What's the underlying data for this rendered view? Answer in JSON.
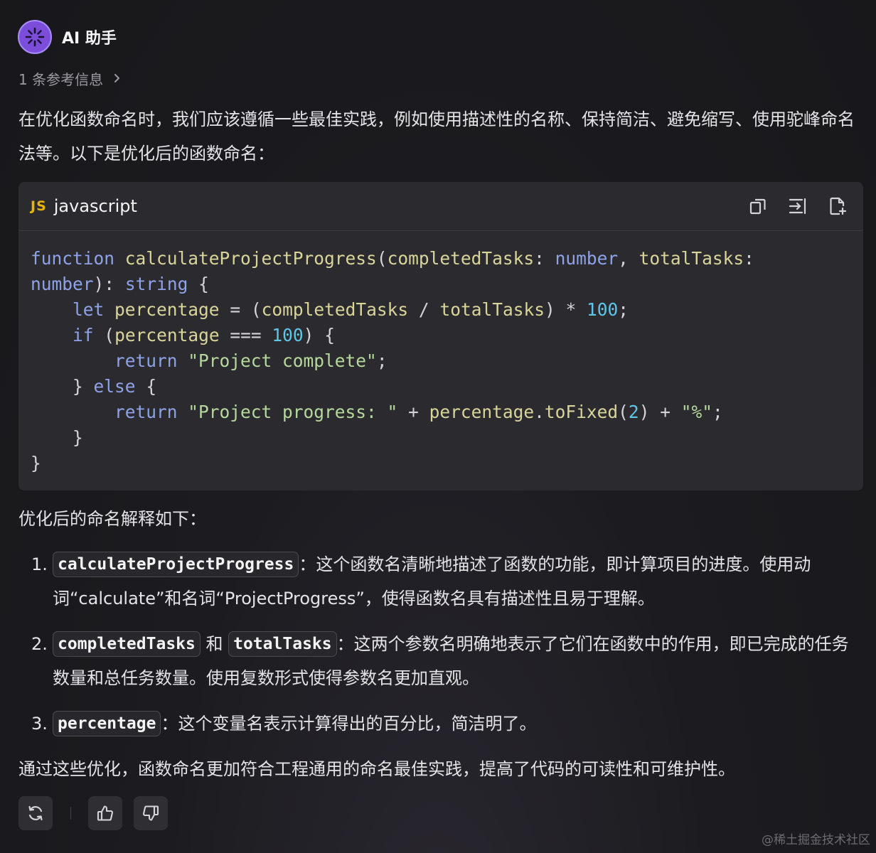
{
  "header": {
    "assistant_name": "AI 助手",
    "avatar_icon": "sparkle-icon",
    "avatar_color": "#7c4ddb"
  },
  "references": {
    "label": "1 条参考信息",
    "icon": "chevron-right-icon"
  },
  "intro_text": "在优化函数命名时，我们应该遵循一些最佳实践，例如使用描述性的名称、保持简洁、避免缩写、使用驼峰命名法等。以下是优化后的函数命名：",
  "code_block": {
    "lang_badge": "JS",
    "language": "javascript",
    "actions": [
      "copy-icon",
      "insert-icon",
      "new-file-icon"
    ],
    "code": "function calculateProjectProgress(completedTasks: number, totalTasks:\nnumber): string {\n    let percentage = (completedTasks / totalTasks) * 100;\n    if (percentage === 100) {\n        return \"Project complete\";\n    } else {\n        return \"Project progress: \" + percentage.toFixed(2) + \"%\";\n    }\n}"
  },
  "explain_title": "优化后的命名解释如下：",
  "explanations": [
    {
      "num": "1.",
      "code1": "calculateProjectProgress",
      "text": "：这个函数名清晰地描述了函数的功能，即计算项目的进度。使用动词“calculate”和名词“ProjectProgress”，使得函数名具有描述性且易于理解。"
    },
    {
      "num": "2.",
      "code1": "completedTasks",
      "joiner": " 和 ",
      "code2": "totalTasks",
      "text": "：这两个参数名明确地表示了它们在函数中的作用，即已完成的任务数量和总任务数量。使用复数形式使得参数名更加直观。"
    },
    {
      "num": "3.",
      "code1": "percentage",
      "text": "：这个变量名表示计算得出的百分比，简洁明了。"
    }
  ],
  "outro_text": "通过这些优化，函数命名更加符合工程通用的命名最佳实践，提高了代码的可读性和可维护性。",
  "feedback": {
    "buttons": [
      "refresh-icon",
      "thumbs-up-icon",
      "thumbs-down-icon"
    ]
  },
  "watermark": "@稀土掘金技术社区"
}
